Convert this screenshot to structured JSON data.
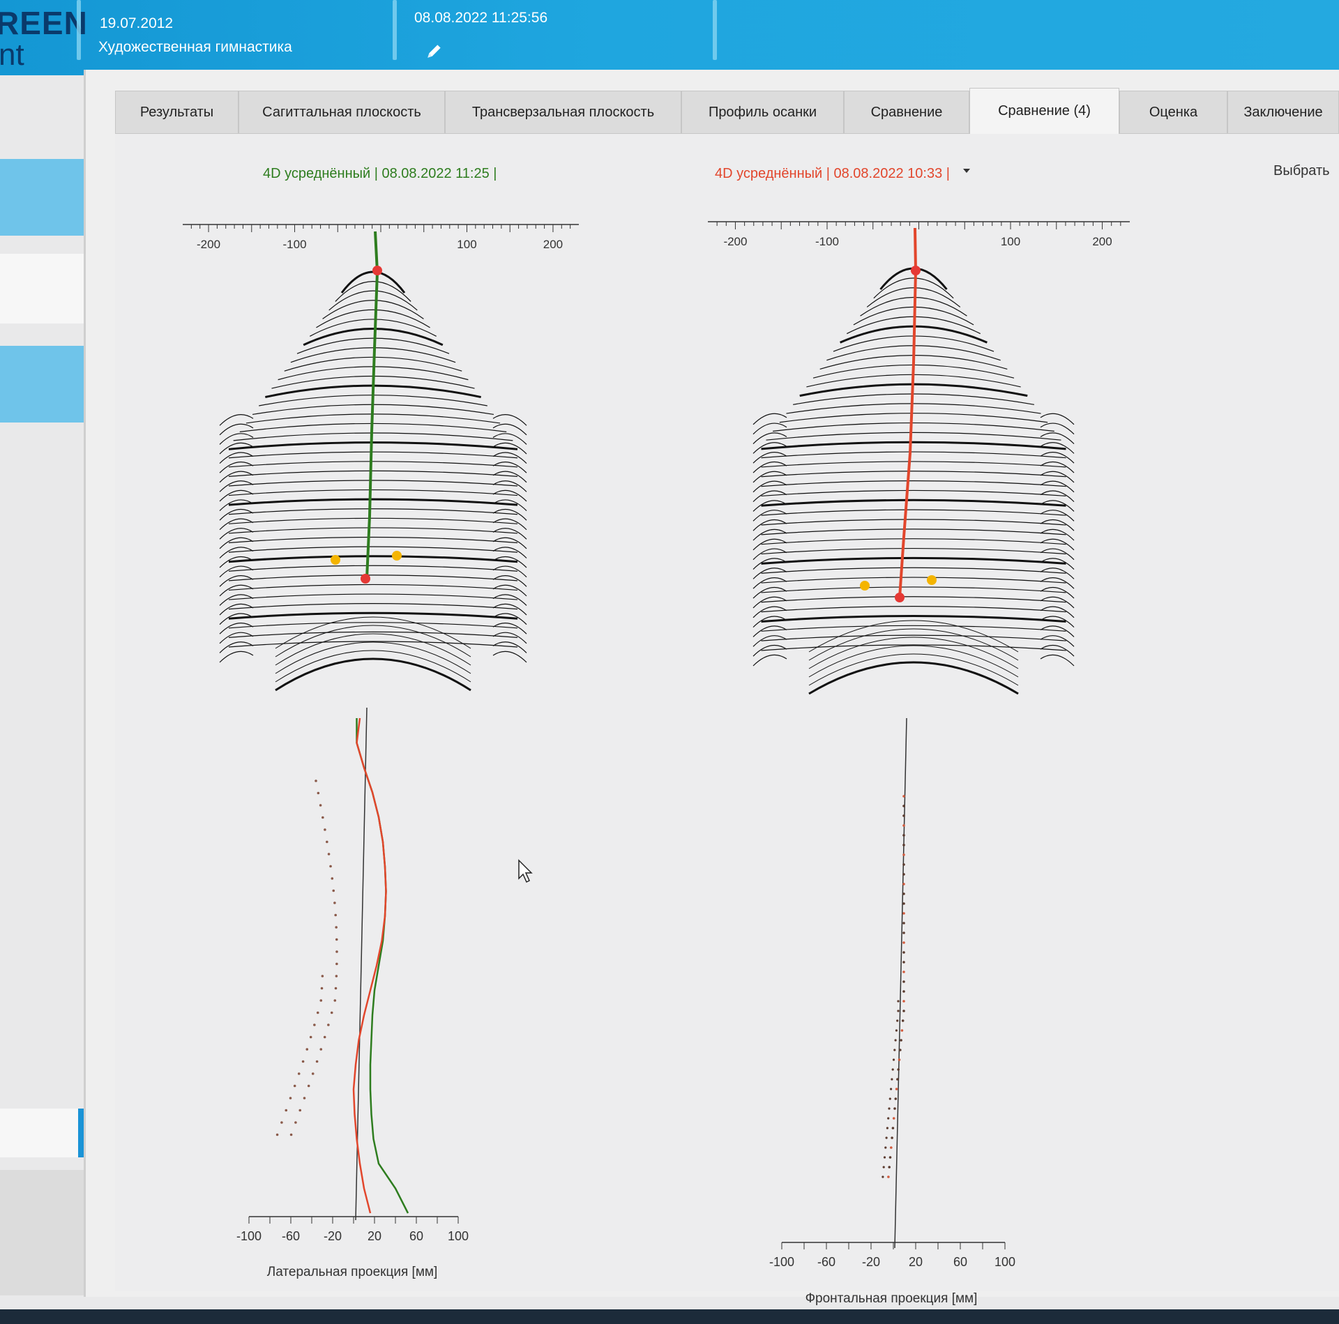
{
  "header": {
    "logo_top": "REEN",
    "logo_bottom": "nt",
    "birth_date": "19.07.2012",
    "sport": "Художественная гимнастика",
    "scan_datetime": "08.08.2022 11:25:56"
  },
  "tabs": [
    {
      "label": "Результаты"
    },
    {
      "label": "Сагиттальная плоскость"
    },
    {
      "label": "Трансверзальная плоскость"
    },
    {
      "label": "Профиль осанки"
    },
    {
      "label": "Сравнение"
    },
    {
      "label": "Сравнение (4)"
    },
    {
      "label": "Оценка"
    },
    {
      "label": "Заключение"
    }
  ],
  "active_tab": "Сравнение (4)",
  "scans": {
    "left_label": "4D усреднённый | 08.08.2022 11:25 |",
    "left_color": "#2e7d1f",
    "right_label": "4D усреднённый | 08.08.2022 10:33 |",
    "right_color": "#e2462c",
    "select_label": "Выбрать"
  },
  "chart_data": [
    {
      "type": "line",
      "description_axis": "top",
      "ticks": [
        -200,
        -100,
        100,
        200
      ],
      "xlim": [
        -230,
        230
      ]
    },
    {
      "type": "line",
      "description_axis": "top",
      "ticks": [
        -200,
        -100,
        100,
        200
      ],
      "xlim": [
        -230,
        230
      ]
    },
    {
      "type": "line",
      "xlabel": "Латеральная проекция [мм]",
      "ticks": [
        -100,
        -60,
        -20,
        20,
        60,
        100
      ],
      "xlim": [
        -100,
        100
      ],
      "series": [
        {
          "color": "#2e7d1f",
          "x": [
            3,
            3,
            10,
            18,
            24,
            28,
            30,
            31,
            30,
            28,
            24,
            20,
            18,
            17,
            16,
            16,
            17,
            19,
            24,
            40,
            52
          ]
        },
        {
          "color": "#e2462c",
          "x": [
            6,
            3,
            10,
            18,
            24,
            28,
            30,
            31,
            30,
            27,
            22,
            16,
            10,
            5,
            2,
            0,
            1,
            3,
            6,
            10,
            16
          ]
        }
      ]
    },
    {
      "type": "scatter",
      "xlabel": "Фронтальная проекция [мм]",
      "ticks": [
        -100,
        -60,
        -20,
        20,
        60,
        100
      ],
      "xlim": [
        -100,
        100
      ]
    }
  ]
}
